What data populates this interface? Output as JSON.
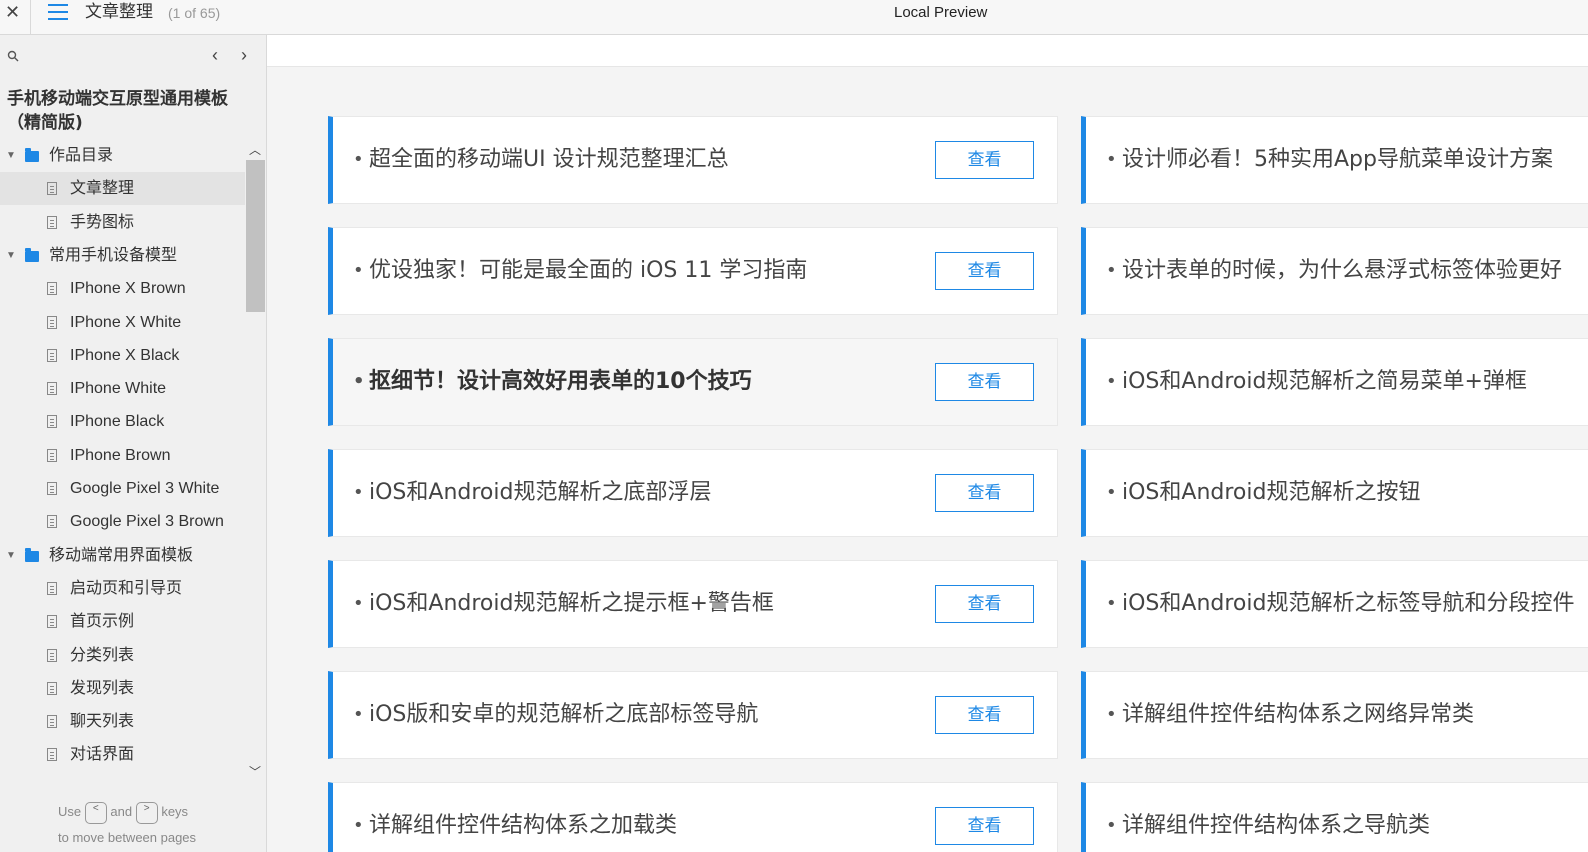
{
  "topbar": {
    "close_glyph": "✕",
    "page_title": "文章整理",
    "page_count": "(1 of 65)",
    "app_title": "Local Preview"
  },
  "sidebar": {
    "project_title": "手机移动端交互原型通用模板（精简版)",
    "nav_prev": "‹",
    "nav_next": "›",
    "folders": [
      {
        "label": "作品目录",
        "items": [
          "文章整理",
          "手势图标"
        ]
      },
      {
        "label": "常用手机设备模型",
        "items": [
          "IPhone X Brown",
          "IPhone X White",
          "IPhone X Black",
          "IPhone White",
          "IPhone Black",
          "IPhone Brown",
          "Google Pixel 3 White",
          "Google Pixel 3 Brown"
        ]
      },
      {
        "label": "移动端常用界面模板",
        "items": [
          "启动页和引导页",
          "首页示例",
          "分类列表",
          "发现列表",
          "聊天列表",
          "对话界面"
        ]
      }
    ],
    "selected_item": "文章整理",
    "hint": {
      "use": "Use",
      "and": "and",
      "keys": "keys",
      "key_prev": "<",
      "key_next": ">",
      "line2": "to move between pages"
    }
  },
  "content": {
    "view_label": "查看",
    "left_cards": [
      "超全面的移动端UI 设计规范整理汇总",
      "优设独家！可能是最全面的 iOS 11 学习指南",
      "抠细节！设计高效好用表单的10个技巧",
      "iOS和Android规范解析之底部浮层",
      "iOS和Android规范解析之提示框+警告框",
      "iOS版和安卓的规范解析之底部标签导航",
      "详解组件控件结构体系之加载类"
    ],
    "right_cards": [
      "设计师必看！5种实用App导航菜单设计方案",
      "设计表单的时候，为什么悬浮式标签体验更好",
      "iOS和Android规范解析之简易菜单+弹框",
      "iOS和Android规范解析之按钮",
      "iOS和Android规范解析之标签导航和分段控件",
      "详解组件控件结构体系之网络异常类",
      "详解组件控件结构体系之导航类"
    ]
  },
  "colors": {
    "accent": "#1e88e5",
    "sidebar_bg": "#f0f0f0",
    "selected_bg": "#e3e3e3"
  }
}
